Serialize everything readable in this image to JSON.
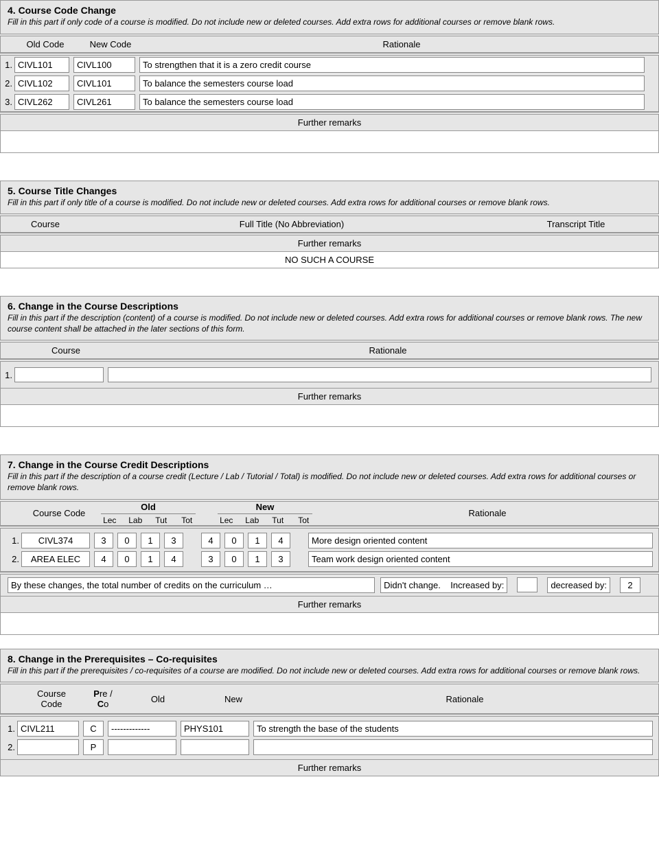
{
  "s4": {
    "title": "4. Course Code Change",
    "desc": "Fill in this part if only code of a course is modified. Do not include new or deleted courses. Add extra rows for additional courses or remove blank rows.",
    "headers": {
      "old": "Old Code",
      "new": "New Code",
      "rationale": "Rationale"
    },
    "rows": [
      {
        "n": "1.",
        "old": "CIVL101",
        "new": "CIVL100",
        "rationale": "To strengthen that it is a zero credit course"
      },
      {
        "n": "2.",
        "old": "CIVL102",
        "new": "CIVL101",
        "rationale": "To balance the semesters course load"
      },
      {
        "n": "3.",
        "old": "CIVL262",
        "new": "CIVL261",
        "rationale": "To balance the semesters course load"
      }
    ],
    "further": "Further remarks",
    "further_body": ""
  },
  "s5": {
    "title": "5. Course Title Changes",
    "desc": "Fill in this part if only title of a course is modified. Do not include new or deleted courses. Add extra rows for additional courses or remove blank rows.",
    "headers": {
      "course": "Course",
      "full": "Full Title (No Abbreviation)",
      "transcript": "Transcript Title"
    },
    "further": "Further remarks",
    "further_body": "NO SUCH A COURSE"
  },
  "s6": {
    "title": "6. Change in the Course Descriptions",
    "desc": "Fill in this part if the description (content) of a course is modified. Do not include new or deleted courses. Add extra rows for additional courses or remove blank rows. The new course content shall be attached in the later sections of this form.",
    "headers": {
      "course": "Course",
      "rationale": "Rationale"
    },
    "rows": [
      {
        "n": "1."
      }
    ],
    "further": "Further remarks",
    "further_body": ""
  },
  "s7": {
    "title": "7. Change in the Course Credit Descriptions",
    "desc": "Fill in this part if the description of a course credit (Lecture / Lab / Tutorial / Total) is modified. Do not include new or deleted courses. Add extra rows for additional courses or remove blank rows.",
    "headers": {
      "course": "Course Code",
      "old": "Old",
      "new": "New",
      "lec": "Lec",
      "lab": "Lab",
      "tut": "Tut",
      "tot": "Tot",
      "rationale": "Rationale"
    },
    "rows": [
      {
        "n": "1.",
        "code": "CIVL374",
        "old": [
          "3",
          "0",
          "1",
          "3"
        ],
        "new": [
          "4",
          "0",
          "1",
          "4"
        ],
        "rationale": "More design oriented content"
      },
      {
        "n": "2.",
        "code": "AREA ELEC",
        "old": [
          "4",
          "0",
          "1",
          "4"
        ],
        "new": [
          "3",
          "0",
          "1",
          "3"
        ],
        "rationale": "Team work design oriented content"
      }
    ],
    "summary": {
      "text": "By these changes, the total number of credits on the curriculum …",
      "didnt": "Didn't change.",
      "inc": "Increased by:",
      "inc_val": "",
      "dec": "decreased by:",
      "dec_val": "2"
    },
    "further": "Further remarks",
    "further_body": ""
  },
  "s8": {
    "title": "8. Change in the Prerequisites – Co-requisites",
    "desc": "Fill in this part if the prerequisites / co-requisites of a course are modified. Do not include new or deleted courses. Add extra rows for additional courses or remove blank rows.",
    "headers": {
      "course": "Course Code",
      "preco_p": "P",
      "preco_rest": "re /",
      "preco_c": "C",
      "preco_o": "o",
      "old": "Old",
      "new": "New",
      "rationale": "Rationale"
    },
    "rows": [
      {
        "n": "1.",
        "code": "CIVL211",
        "pc": "C",
        "old": "-------------",
        "new": "PHYS101",
        "rationale": "To strength the base of the students"
      },
      {
        "n": "2.",
        "code": "",
        "pc": "P",
        "old": "",
        "new": "",
        "rationale": ""
      }
    ],
    "further": "Further remarks"
  }
}
